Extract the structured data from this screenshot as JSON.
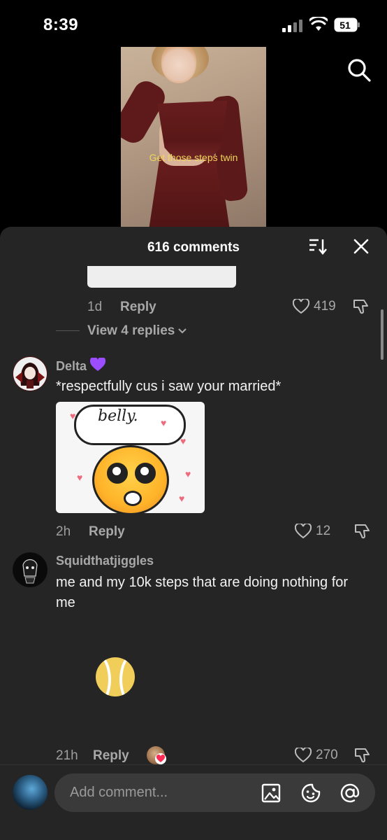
{
  "status_bar": {
    "time": "8:39",
    "battery": "51"
  },
  "video": {
    "caption": "Get those steps twin"
  },
  "comments_panel": {
    "title": "616 comments"
  },
  "previous_comment": {
    "age": "1d",
    "reply_label": "Reply",
    "likes": "419",
    "view_replies": "View 4 replies"
  },
  "comments": [
    {
      "username": "Delta",
      "text": "*respectfully cus i saw your married*",
      "sticker_text": "belly.",
      "age": "2h",
      "reply_label": "Reply",
      "likes": "12"
    },
    {
      "username": "Squidthatjiggles",
      "text": "me and my 10k steps that are doing nothing for me",
      "age": "21h",
      "reply_label": "Reply",
      "likes": "270"
    }
  ],
  "composer": {
    "placeholder": "Add comment..."
  },
  "colors": {
    "sheet_bg": "#252525",
    "caption": "#f0d65b",
    "accent_purple": "#9b4dff"
  }
}
